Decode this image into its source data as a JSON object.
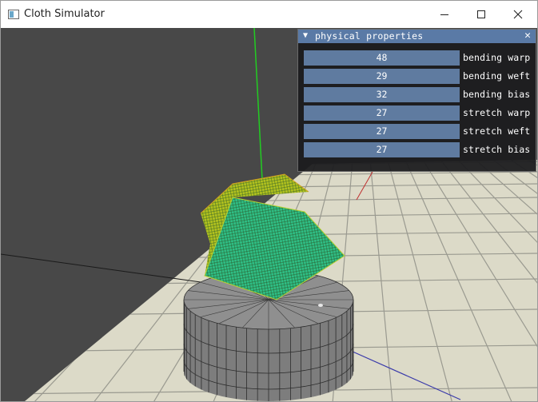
{
  "window": {
    "title": "Cloth Simulator",
    "controls": [
      "minimize",
      "maximize",
      "close"
    ]
  },
  "panel": {
    "title": "physical properties",
    "collapse_icon": "triangle-down-icon",
    "close_icon": "close-icon",
    "properties": [
      {
        "value": "48",
        "label": "bending warp"
      },
      {
        "value": "29",
        "label": "bending weft"
      },
      {
        "value": "32",
        "label": "bending bias"
      },
      {
        "value": "27",
        "label": "stretch warp"
      },
      {
        "value": "27",
        "label": "stretch weft"
      },
      {
        "value": "27",
        "label": "stretch bias"
      }
    ]
  },
  "colors": {
    "title_accent": "#5a7aa6",
    "slider_fill": "#5f7ba0",
    "background": "#484848",
    "floor": "#dcdac8",
    "cloth_front": "#2fbf86",
    "cloth_back": "#b3c21e",
    "cylinder": "#8a8a8a"
  }
}
